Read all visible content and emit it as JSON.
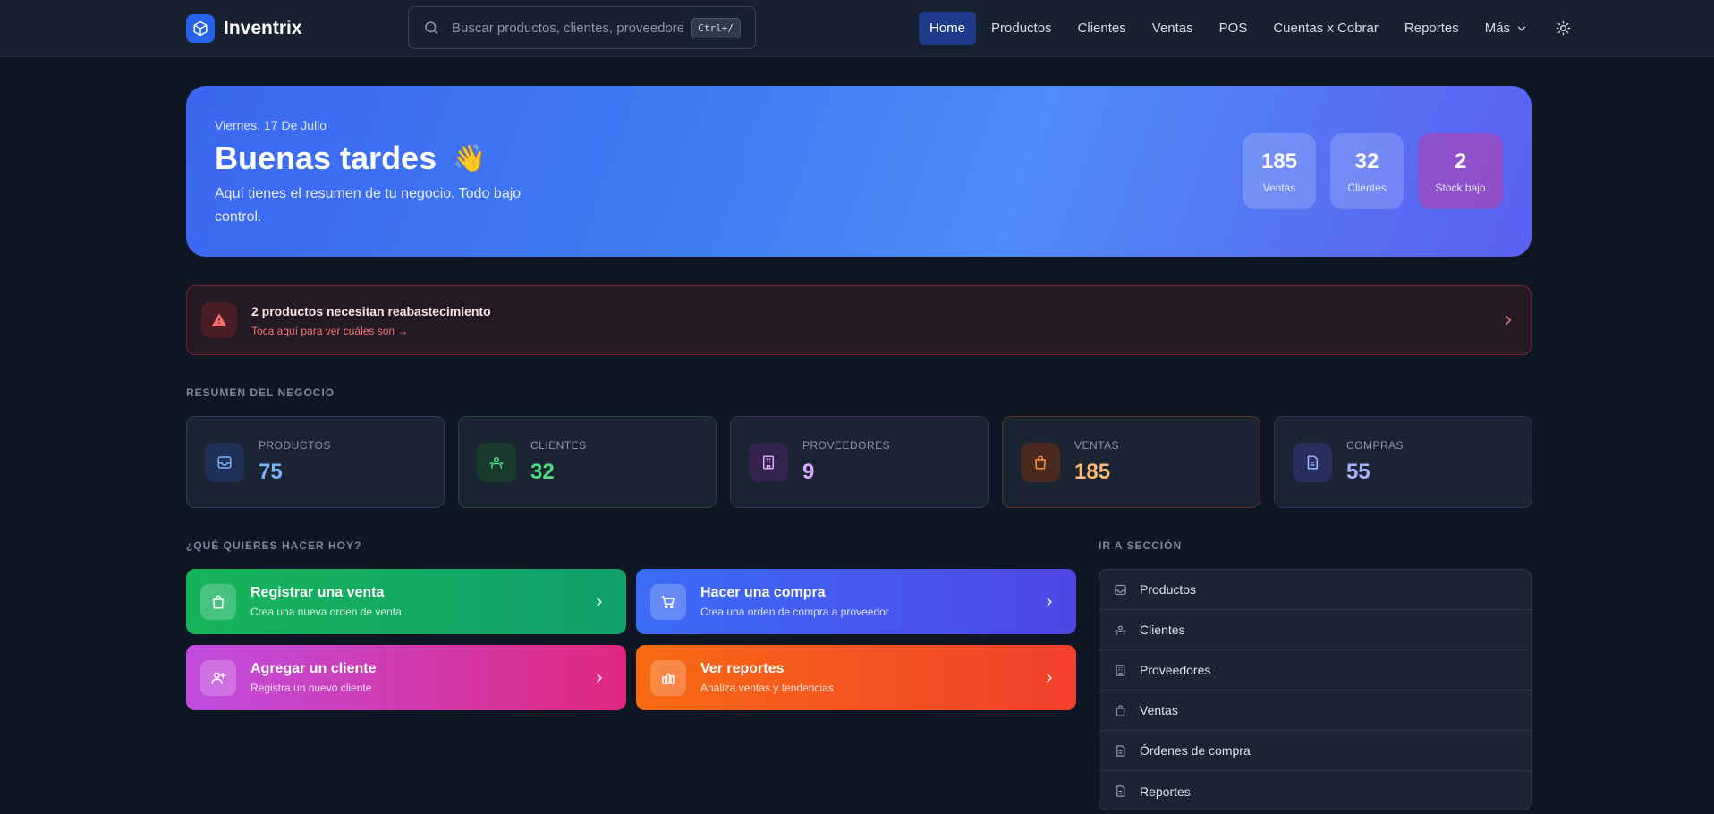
{
  "app": {
    "name": "Inventrix",
    "logo_icon": "cube-icon"
  },
  "search": {
    "placeholder": "Buscar productos, clientes, proveedores...",
    "value": "",
    "shortcut": "Ctrl+/"
  },
  "nav": {
    "items": [
      {
        "label": "Home",
        "active": true
      },
      {
        "label": "Productos"
      },
      {
        "label": "Clientes"
      },
      {
        "label": "Ventas"
      },
      {
        "label": "POS"
      },
      {
        "label": "Cuentas x Cobrar"
      },
      {
        "label": "Reportes"
      },
      {
        "label": "Más",
        "icon": "chevron-down-icon"
      }
    ],
    "theme_icon": "sun-icon"
  },
  "hero": {
    "date": "Viernes, 17 De Julio",
    "greeting": "Buenas tardes",
    "emoji": "👋",
    "subtitle": "Aquí tienes el resumen de tu negocio. Todo bajo control.",
    "stats": [
      {
        "value": "185",
        "label": "Ventas"
      },
      {
        "value": "32",
        "label": "Clientes"
      },
      {
        "value": "2",
        "label": "Stock bajo"
      }
    ]
  },
  "alert": {
    "title": "2 productos necesitan reabastecimiento",
    "subtitle": "Toca aquí para ver cuáles son →",
    "icon": "warning-icon"
  },
  "summary": {
    "label": "RESUMEN DEL NEGOCIO",
    "cards": [
      {
        "label": "PRODUCTOS",
        "value": "75",
        "icon": "inbox-icon",
        "color": "#7cb3ff"
      },
      {
        "label": "CLIENTES",
        "value": "32",
        "icon": "users-icon",
        "color": "#4ade80"
      },
      {
        "label": "PROVEEDORES",
        "value": "9",
        "icon": "building-icon",
        "color": "#d8a8ff"
      },
      {
        "label": "VENTAS",
        "value": "185",
        "icon": "bag-icon",
        "color": "#fdba74"
      },
      {
        "label": "COMPRAS",
        "value": "55",
        "icon": "file-icon",
        "color": "#a5b4fc"
      }
    ]
  },
  "actions": {
    "label": "¿QUÉ QUIERES HACER HOY?",
    "items": [
      {
        "title": "Registrar una venta",
        "subtitle": "Crea una nueva orden de venta",
        "icon": "bag-icon"
      },
      {
        "title": "Hacer una compra",
        "subtitle": "Crea una orden de compra a proveedor",
        "icon": "cart-icon"
      },
      {
        "title": "Agregar un cliente",
        "subtitle": "Registra un nuevo cliente",
        "icon": "user-plus-icon"
      },
      {
        "title": "Ver reportes",
        "subtitle": "Analiza ventas y tendencias",
        "icon": "bar-chart-icon"
      }
    ]
  },
  "sections": {
    "label": "IR A SECCIÓN",
    "items": [
      {
        "label": "Productos",
        "icon": "inbox-icon"
      },
      {
        "label": "Clientes",
        "icon": "users-icon"
      },
      {
        "label": "Proveedores",
        "icon": "building-icon"
      },
      {
        "label": "Ventas",
        "icon": "bag-icon"
      },
      {
        "label": "Órdenes de compra",
        "icon": "file-icon"
      },
      {
        "label": "Reportes",
        "icon": "file-icon"
      }
    ]
  }
}
